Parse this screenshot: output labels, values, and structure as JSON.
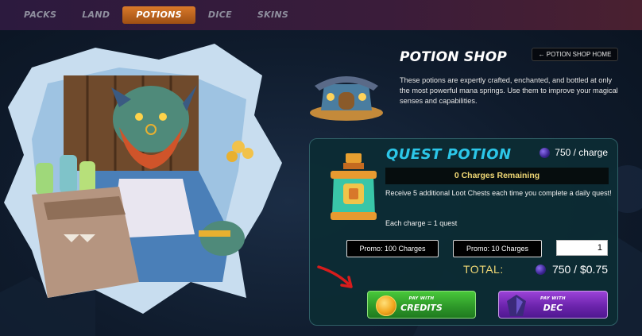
{
  "nav": {
    "tabs": [
      {
        "label": "PACKS",
        "active": false
      },
      {
        "label": "LAND",
        "active": false
      },
      {
        "label": "POTIONS",
        "active": true
      },
      {
        "label": "DICE",
        "active": false
      },
      {
        "label": "SKINS",
        "active": false
      }
    ]
  },
  "shop": {
    "title": "POTION SHOP",
    "home_button": "← POTION SHOP HOME",
    "description": "These potions are expertly crafted, enchanted, and bottled at only the most powerful mana springs. Use them to improve your magical senses and capabilities."
  },
  "potion": {
    "name": "QUEST POTION",
    "price": "750 / charge",
    "charges_remaining": "0 Charges Remaining",
    "description": "Receive 5 additional Loot Chests each time you complete a daily quest!",
    "charge_note": "Each charge = 1 quest",
    "promo_100": "Promo: 100 Charges",
    "promo_10": "Promo: 10 Charges",
    "quantity": "1",
    "total_label": "TOTAL:",
    "total_value": "750 / $0.75"
  },
  "pay": {
    "credits_small": "PAY WITH",
    "credits_big": "CREDITS",
    "dec_small": "PAY WITH",
    "dec_big": "DEC"
  },
  "colors": {
    "accent_cyan": "#2cc6e8",
    "gold": "#f0d875",
    "nav_active": "#d9792a",
    "credits_green": "#2f9a2a",
    "dec_purple": "#6c24ad"
  }
}
